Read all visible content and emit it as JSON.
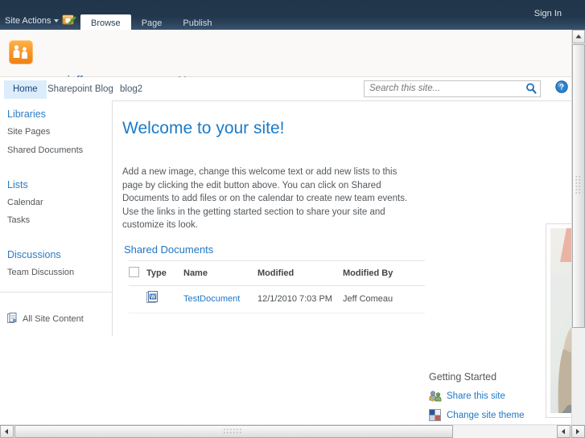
{
  "ribbon": {
    "site_actions_label": "Site Actions",
    "nav_up_icon": "navigate-up-edit-icon",
    "tabs": [
      {
        "label": "Browse",
        "active": true
      },
      {
        "label": "Page",
        "active": false
      },
      {
        "label": "Publish",
        "active": false
      }
    ],
    "sign_in_label": "Sign In"
  },
  "site_header": {
    "logo_icon": "people-group-logo",
    "site_url": "www.jeffreycomeau.com",
    "breadcrumb_separator": "▸",
    "current_page": "Home"
  },
  "topnav": {
    "items": [
      {
        "label": "Home",
        "selected": true
      },
      {
        "label": "Sharepoint Blog",
        "selected": false
      },
      {
        "label": "blog2",
        "selected": false
      }
    ],
    "search": {
      "placeholder": "Search this site...",
      "value": "",
      "button_icon": "search-icon"
    },
    "help_icon": "help-question-icon"
  },
  "sidebar": {
    "groups": [
      {
        "heading": "Libraries",
        "links": [
          "Site Pages",
          "Shared Documents"
        ]
      },
      {
        "heading": "Lists",
        "links": [
          "Calendar",
          "Tasks"
        ]
      },
      {
        "heading": "Discussions",
        "links": [
          "Team Discussion"
        ]
      }
    ],
    "all_site_content": {
      "label": "All Site Content",
      "icon": "documents-stack-icon"
    }
  },
  "main": {
    "welcome_title": "Welcome to your site!",
    "welcome_body": "Add a new image, change this welcome text or add new lists to this page by clicking the edit button above. You can click on Shared Documents to add files or on the calendar to create new team events. Use the links in the getting started section to share your site and customize its look.",
    "shared_documents": {
      "title": "Shared Documents",
      "columns": [
        "Type",
        "Name",
        "Modified",
        "Modified By"
      ],
      "select_all_checkbox": "select-all",
      "rows": [
        {
          "type_icon": "word-document-icon",
          "name": "TestDocument",
          "modified": "12/1/2010 7:03 PM",
          "modified_by": "Jeff Comeau"
        }
      ]
    },
    "image_panel": {
      "alt": "woman-with-laptop-photo"
    }
  },
  "getting_started": {
    "heading": "Getting Started",
    "links": [
      {
        "label": "Share this site",
        "icon": "share-people-icon"
      },
      {
        "label": "Change site theme",
        "icon": "color-swatch-icon"
      }
    ]
  },
  "colors": {
    "ribbon_dark": "#21364b",
    "accent_blue": "#1f77c4",
    "heading_blue": "#2b7bc4",
    "logo_orange": "#f79327",
    "nav_selected_bg": "#dcecfa"
  },
  "scrollbars": {
    "vertical_outer": "window-vertical-scrollbar",
    "vertical_inner": "content-vertical-scrollbar",
    "horizontal": "window-horizontal-scrollbar"
  }
}
